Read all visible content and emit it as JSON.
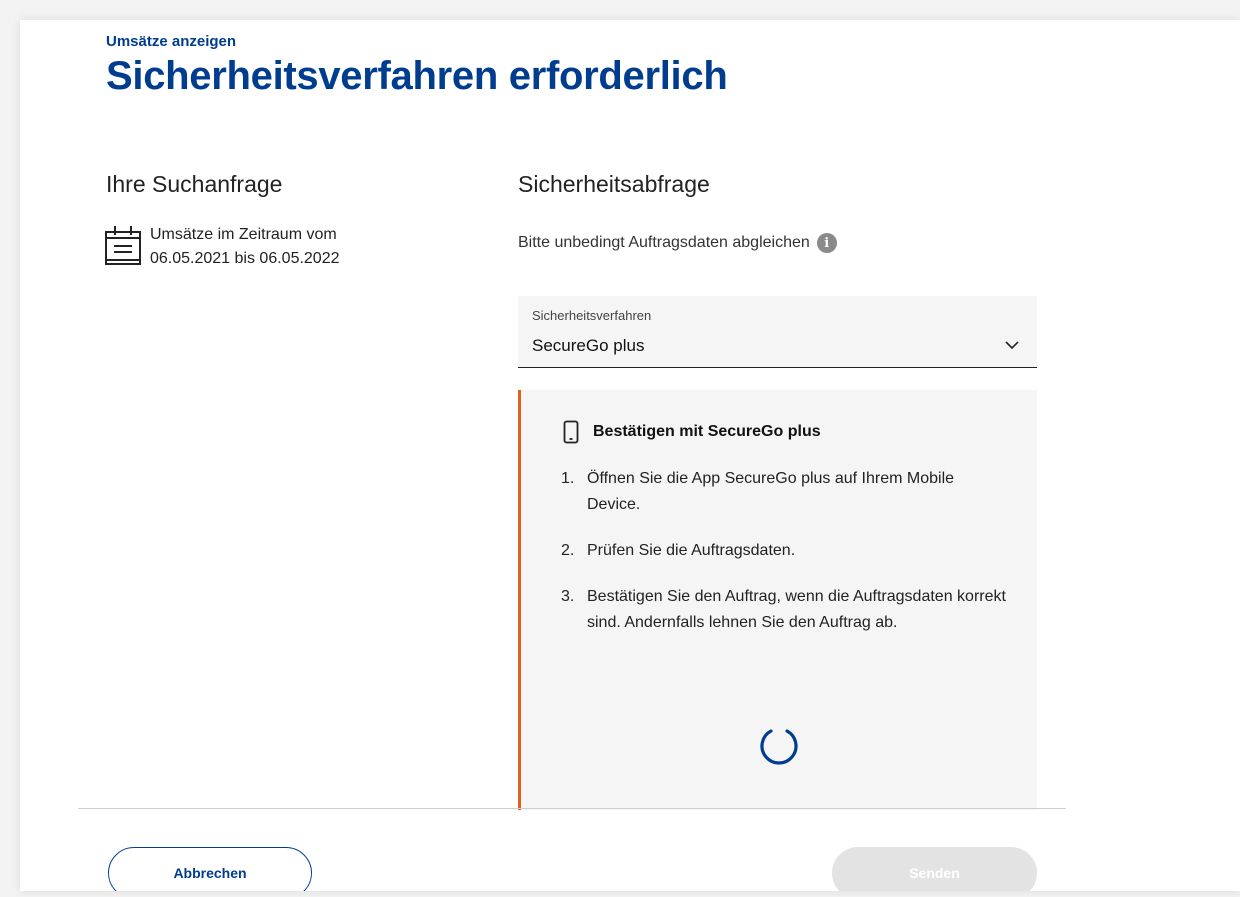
{
  "header": {
    "breadcrumb": "Umsätze anzeigen",
    "title": "Sicherheitsverfahren erforderlich"
  },
  "search": {
    "heading": "Ihre Suchanfrage",
    "line1": "Umsätze im Zeitraum vom",
    "line2": "06.05.2021 bis 06.05.2022",
    "icon": "calendar-icon"
  },
  "security": {
    "heading": "Sicherheitsabfrage",
    "hint": "Bitte unbedingt Auftragsdaten abgleichen",
    "info_icon": "info-icon",
    "select": {
      "label": "Sicherheitsverfahren",
      "value": "SecureGo plus"
    },
    "panel": {
      "title": "Bestätigen mit SecureGo plus",
      "icon": "smartphone-icon",
      "steps": [
        {
          "num": "1.",
          "text": "Öffnen Sie die App SecureGo plus auf Ihrem Mobile Device."
        },
        {
          "num": "2.",
          "text": "Prüfen Sie die Auftragsdaten."
        },
        {
          "num": "3.",
          "text": "Bestätigen Sie den Auftrag, wenn die Auftragsdaten korrekt sind. Andernfalls lehnen Sie den Auftrag ab."
        }
      ],
      "accent_color": "#e0621a"
    }
  },
  "actions": {
    "cancel": "Abbrechen",
    "send": "Senden"
  },
  "colors": {
    "brand": "#003d8f",
    "panel_bg": "#f5f5f5",
    "disabled": "#e3e3e3"
  }
}
